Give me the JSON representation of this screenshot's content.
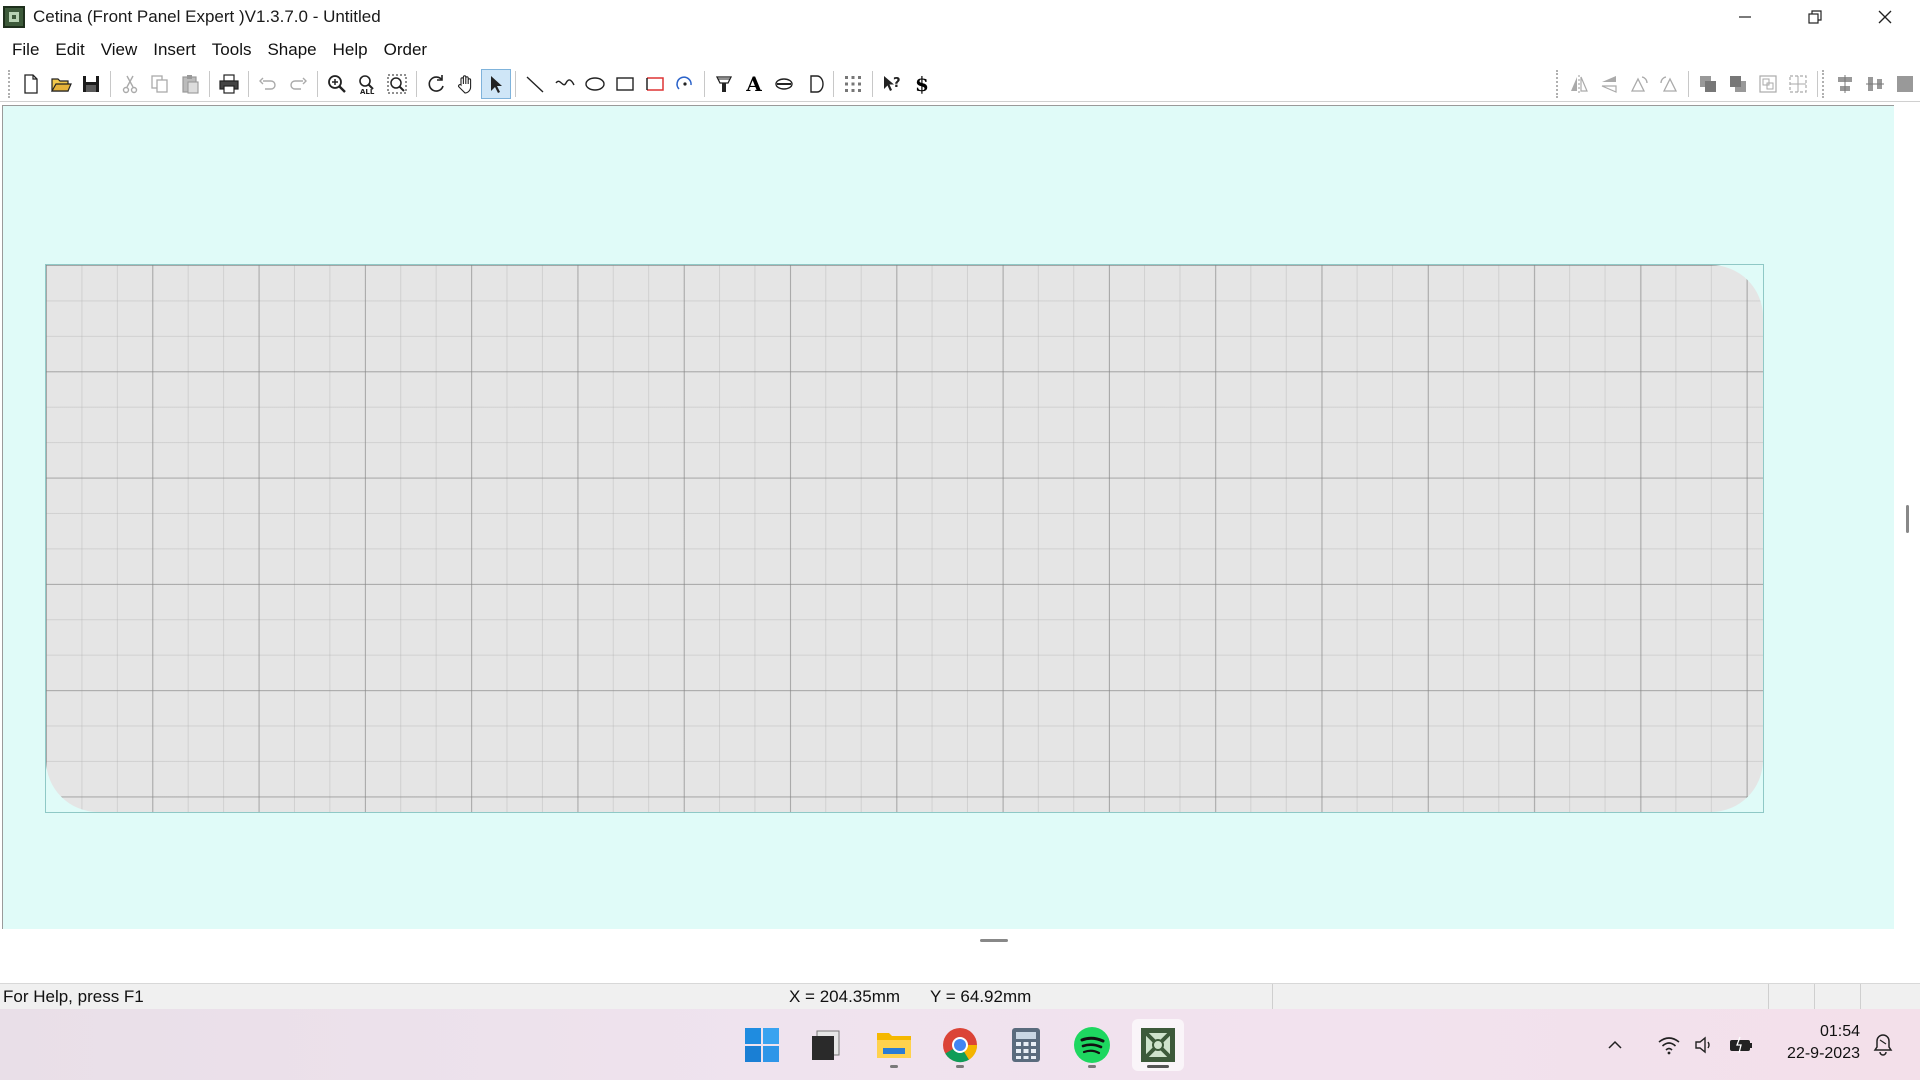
{
  "window": {
    "title": "Cetina (Front Panel Expert )V1.3.7.0 - Untitled"
  },
  "menu": {
    "items": [
      "File",
      "Edit",
      "View",
      "Insert",
      "Tools",
      "Shape",
      "Help",
      "Order"
    ]
  },
  "toolbar": {
    "text_tool_label": "A",
    "help_tool_label": "?",
    "price_tool_label": "$",
    "active_tool": "select-arrow"
  },
  "status": {
    "help": "For Help, press F1",
    "x": "X = 204.35mm",
    "y": "Y = 64.92mm"
  },
  "taskbar": {
    "time": "01:54",
    "date": "22-9-2023"
  },
  "colors": {
    "canvas_background": "#e0fbf8",
    "panel_fill": "#e5e5e5",
    "grid_lines": "#8a8a8a",
    "accent": "#3d5a3a"
  }
}
